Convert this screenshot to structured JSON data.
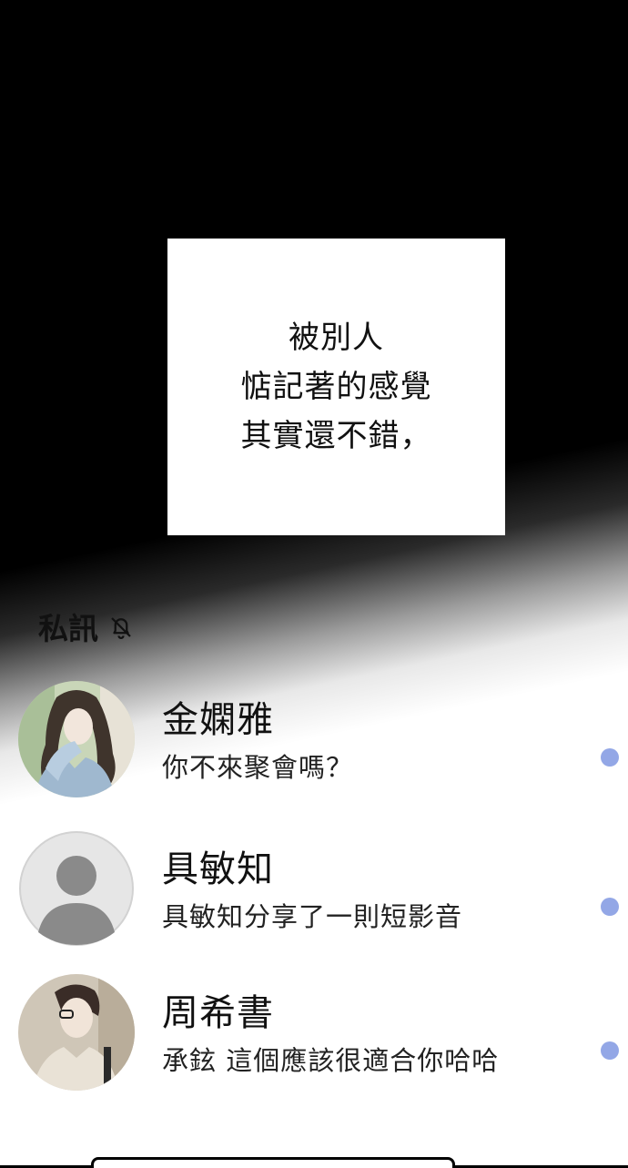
{
  "caption": {
    "lines": [
      "被別人",
      "惦記著的感覺",
      "其實還不錯，"
    ]
  },
  "messages_section": {
    "title": "私訊",
    "icon": "bell-off-icon"
  },
  "chats": [
    {
      "name": "金嫻雅",
      "preview": "你不來聚會嗎？",
      "unread": true,
      "avatar": "photo-woman-long-hair"
    },
    {
      "name": "具敏知",
      "preview": "具敏知分享了一則短影音",
      "unread": true,
      "avatar": "default-user-icon"
    },
    {
      "name": "周希書",
      "preview": "承鉉 這個應該很適合你哈哈",
      "unread": true,
      "avatar": "photo-woman-glasses"
    }
  ],
  "colors": {
    "unread_dot": "#93a7e6",
    "default_avatar_bg": "#e6e6e6",
    "default_avatar_fg": "#8a8a8a"
  }
}
